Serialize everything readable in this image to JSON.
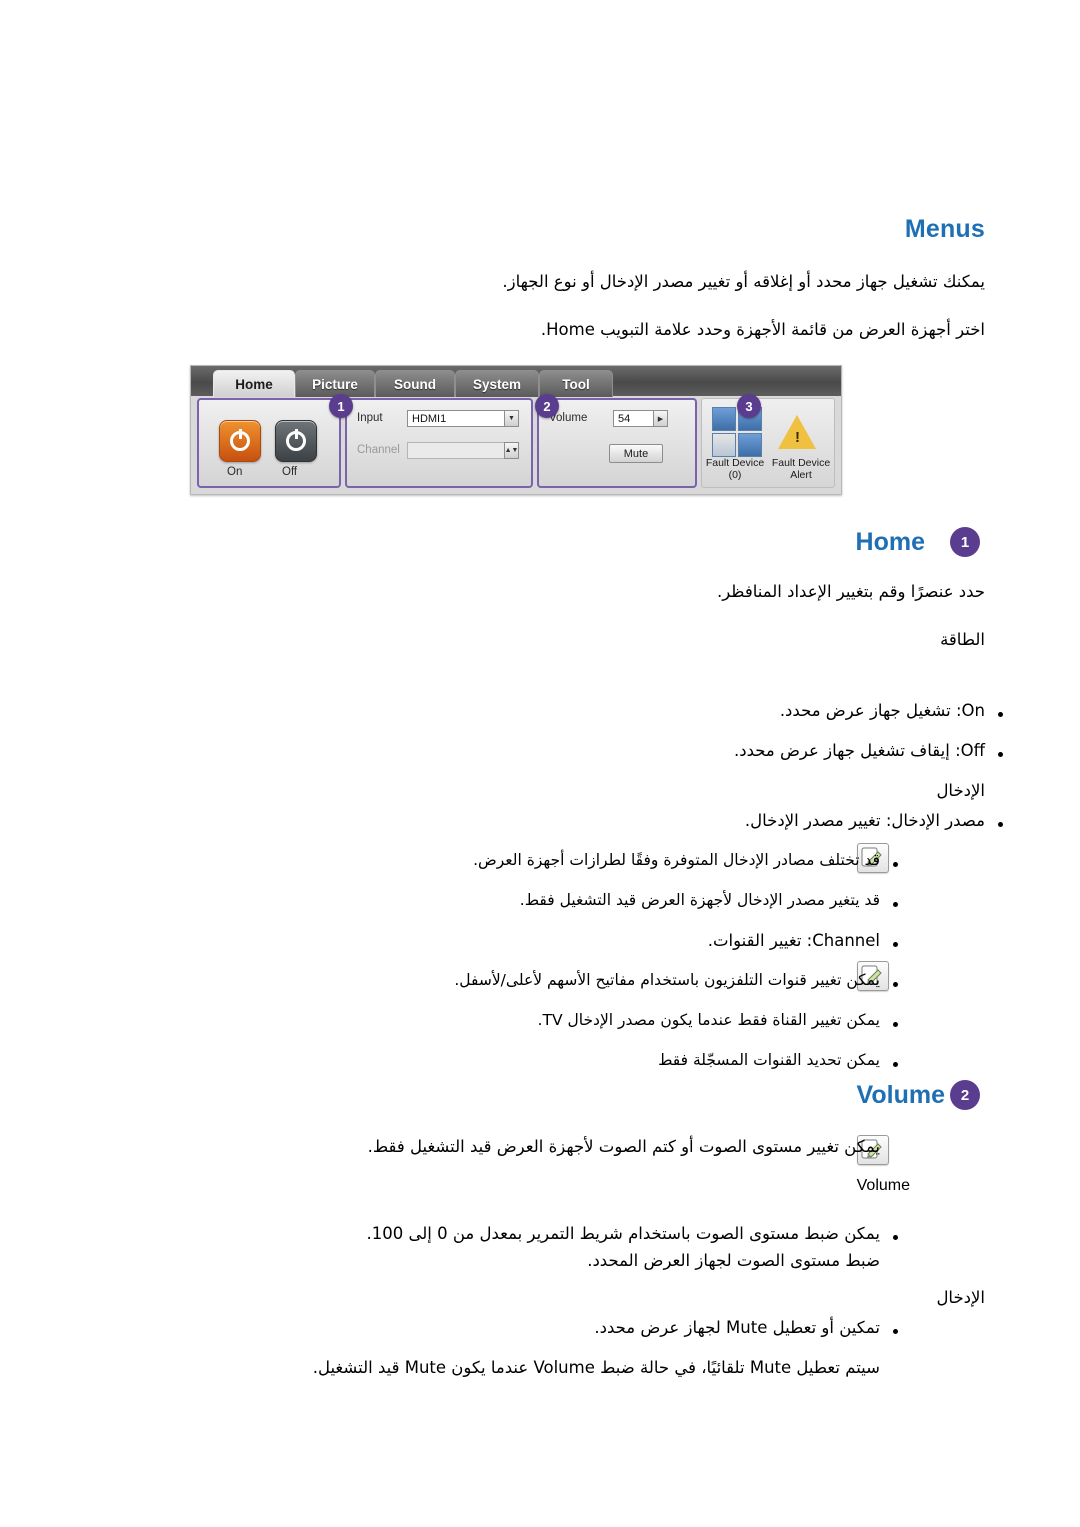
{
  "headings": {
    "menus": "Menus",
    "home": "Home",
    "home_badge": "1",
    "volume": "Volume",
    "volume_badge": "2"
  },
  "intro": {
    "line1": "يمكنك تشغيل جهاز محدد أو إغلاقه أو تغيير مصدر الإدخال أو نوع الجهاز.",
    "line2": "اختر أجهزة العرض من قائمة الأجهزة وحدد علامة التبويب Home."
  },
  "osd": {
    "tabs": [
      {
        "label": "Home",
        "active": true
      },
      {
        "label": "Picture",
        "active": false
      },
      {
        "label": "Sound",
        "active": false
      },
      {
        "label": "System",
        "active": false
      },
      {
        "label": "Tool",
        "active": false
      }
    ],
    "badges": [
      "1",
      "2",
      "3"
    ],
    "power": {
      "on_label": "On",
      "off_label": "Off",
      "on_icon": "power-icon",
      "off_icon": "power-icon"
    },
    "input_panel": {
      "input_label": "Input",
      "input_value": "HDMI1",
      "channel_label": "Channel",
      "channel_value": ""
    },
    "volume_panel": {
      "volume_label": "Volume",
      "volume_value": "54",
      "mute_label": "Mute"
    },
    "fault_panel": {
      "device_caption_line1": "Fault Device",
      "device_caption_line2": "(0)",
      "alert_caption_line1": "Fault Device",
      "alert_caption_line2": "Alert"
    }
  },
  "home_section": {
    "lead": "حدد عنصرًا وقم بتغيير الإعداد المنافظر.",
    "power_label": "الطاقة",
    "bullets": [
      "On: تشغيل جهاز عرض محدد.",
      "Off: إيقاف تشغيل جهاز عرض محدد."
    ],
    "input_label": "الإدخال",
    "input_bullets": [
      "مصدر الإدخال: تغيير مصدر الإدخال.",
      "قد تختلف مصادر الإدخال المتوفرة وفقًا لطرازات أجهزة العرض.",
      "قد يتغير مصدر الإدخال لأجهزة العرض قيد التشغيل فقط."
    ],
    "channel_bullets": [
      "Channel: تغيير القنوات.",
      "يمكن تغيير قنوات التلفزيون باستخدام مفاتيح الأسهم لأعلى/لأسفل.",
      "يمكن تغيير القناة فقط عندما يكون مصدر الإدخال TV.",
      "يمكن تحديد القنوات المسجّلة فقط"
    ],
    "note_icons": [
      "note-icon",
      "note-icon"
    ]
  },
  "volume_section": {
    "lead": "يمكن تغيير مستوى الصوت أو كتم الصوت لأجهزة العرض قيد التشغيل فقط.",
    "note_icon": "note-icon",
    "volume_label": "Volume",
    "bullets": [
      "يمكن ضبط مستوى الصوت باستخدام شريط التمرير بمعدل من 0 إلى 100.",
      "ضبط مستوى الصوت لجهاز العرض المحدد."
    ],
    "input_label": "الإدخال",
    "mute_bullets": [
      "تمكين أو تعطيل Mute لجهاز عرض محدد.",
      "سيتم تعطيل Mute تلقائيًا، في حالة ضبط Volume عندما يكون Mute قيد التشغيل."
    ]
  },
  "colors": {
    "heading_blue": "#1f6fb5",
    "badge_purple": "#5b3d8f",
    "panel_outline": "#7b62ad"
  }
}
